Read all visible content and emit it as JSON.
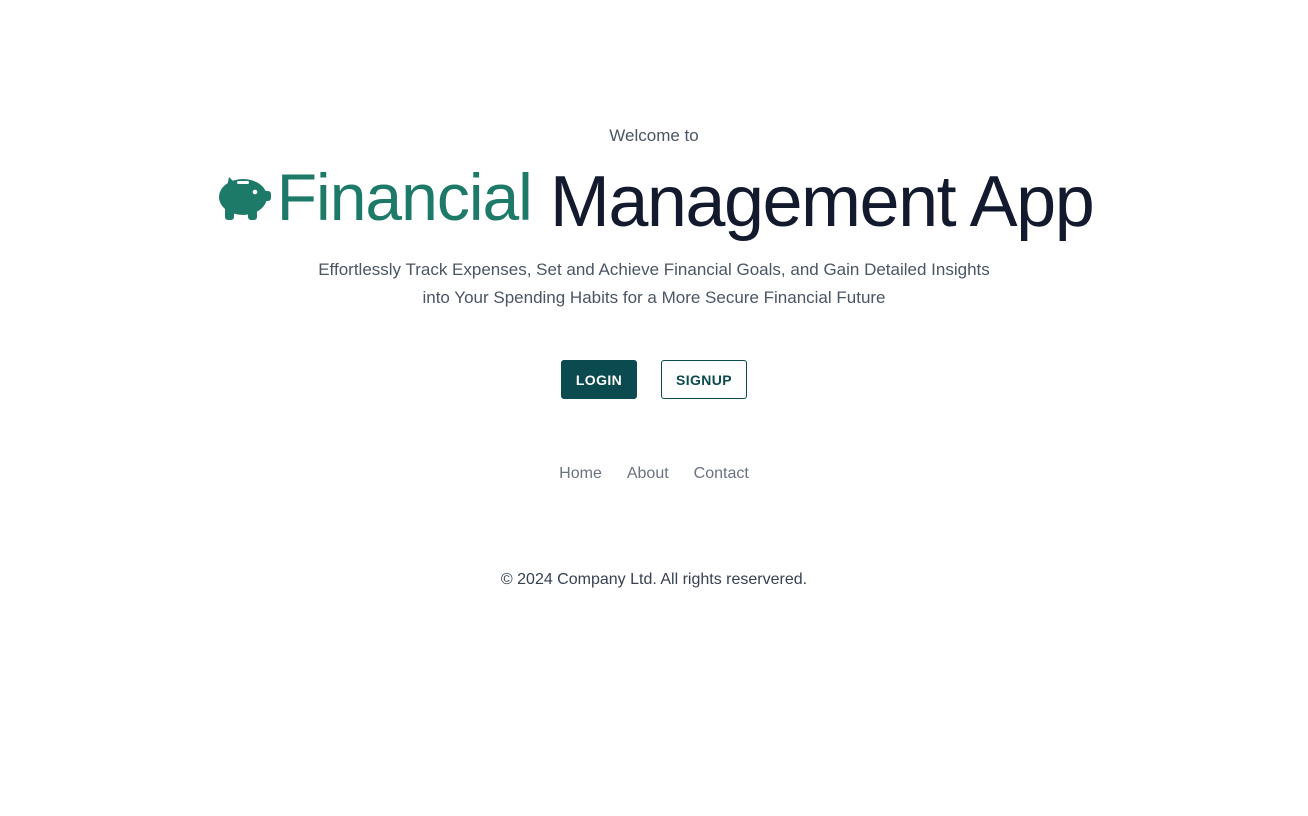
{
  "header": {
    "welcome_text": "Welcome to",
    "logo_text": "Financial",
    "title_rest": "Management App",
    "logo_icon": "piggy-bank-icon"
  },
  "tagline": {
    "line1": "Effortlessly Track Expenses, Set and Achieve Financial Goals, and Gain Detailed Insights",
    "line2": "into Your Spending Habits for a More Secure Financial Future"
  },
  "actions": {
    "login_label": "LOGIN",
    "signup_label": "SIGNUP"
  },
  "nav": {
    "items": [
      {
        "label": "Home"
      },
      {
        "label": "About"
      },
      {
        "label": "Contact"
      }
    ]
  },
  "footer": {
    "copyright": "© 2024 Company Ltd. All rights reservered."
  },
  "colors": {
    "brand_green": "#1e7a68",
    "title_dark": "#141a2e",
    "button_primary": "#0b4a4f",
    "muted_text": "#6b7280"
  }
}
